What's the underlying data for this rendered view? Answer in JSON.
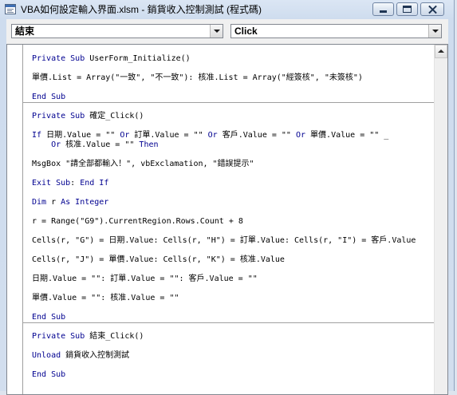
{
  "window": {
    "title": "VBA如何設定輸入界面.xlsm - 銷貨收入控制測試 (程式碼)",
    "icon": "code-window-icon",
    "caption_buttons": [
      "minimize-icon",
      "maximize-icon",
      "close-icon"
    ]
  },
  "toolbar": {
    "object_dropdown": {
      "value": "結束",
      "icon": "dropdown-arrow-icon"
    },
    "procedure_dropdown": {
      "value": "Click",
      "icon": "dropdown-arrow-icon"
    }
  },
  "editor": {
    "colors": {
      "keyword": "#000090",
      "text": "#000000",
      "separator": "#a0a0a0",
      "background": "#ffffff"
    },
    "scrollbar": {
      "icon": "scroll-up-arrow-icon"
    },
    "procedures": [
      {
        "lines": [
          [
            {
              "text": "Private Sub",
              "keyword": true
            },
            {
              "text": " UserForm_Initialize()"
            }
          ],
          [],
          [
            {
              "text": "單價.List = Array(\"一致\", \"不一致\"): 核准.List = Array(\"經簽核\", \"未簽核\")"
            }
          ],
          [],
          [
            {
              "text": "End Sub",
              "keyword": true
            }
          ]
        ]
      },
      {
        "lines": [
          [],
          [
            {
              "text": "Private Sub",
              "keyword": true
            },
            {
              "text": " 確定_Click()"
            }
          ],
          [],
          [
            {
              "text": "If",
              "keyword": true
            },
            {
              "text": " 日期.Value = \"\" "
            },
            {
              "text": "Or",
              "keyword": true
            },
            {
              "text": " 訂單.Value = \"\" "
            },
            {
              "text": "Or",
              "keyword": true
            },
            {
              "text": " 客戶.Value = \"\" "
            },
            {
              "text": "Or",
              "keyword": true
            },
            {
              "text": " 單價.Value = \"\" _"
            }
          ],
          [
            {
              "text": "    "
            },
            {
              "text": "Or",
              "keyword": true
            },
            {
              "text": " 核准.Value = \"\" "
            },
            {
              "text": "Then",
              "keyword": true
            }
          ],
          [],
          [
            {
              "text": "MsgBox \"請全部都輸入！\", vbExclamation, \"錯誤提示\""
            }
          ],
          [],
          [
            {
              "text": "Exit Sub",
              "keyword": true
            },
            {
              "text": ": "
            },
            {
              "text": "End If",
              "keyword": true
            }
          ],
          [],
          [
            {
              "text": "Dim",
              "keyword": true
            },
            {
              "text": " r "
            },
            {
              "text": "As Integer",
              "keyword": true
            }
          ],
          [],
          [
            {
              "text": "r = Range(\"G9\").CurrentRegion.Rows.Count + 8"
            }
          ],
          [],
          [
            {
              "text": "Cells(r, \"G\") = 日期.Value: Cells(r, \"H\") = 訂單.Value: Cells(r, \"I\") = 客戶.Value"
            }
          ],
          [],
          [
            {
              "text": "Cells(r, \"J\") = 單價.Value: Cells(r, \"K\") = 核准.Value"
            }
          ],
          [],
          [
            {
              "text": "日期.Value = \"\": 訂單.Value = \"\": 客戶.Value = \"\""
            }
          ],
          [],
          [
            {
              "text": "單價.Value = \"\": 核准.Value = \"\""
            }
          ],
          [],
          [
            {
              "text": "End Sub",
              "keyword": true
            }
          ]
        ]
      },
      {
        "lines": [
          [],
          [
            {
              "text": "Private Sub",
              "keyword": true
            },
            {
              "text": " 結束_Click()"
            }
          ],
          [],
          [
            {
              "text": "Unload",
              "keyword": true
            },
            {
              "text": " 銷貨收入控制測試"
            }
          ],
          [],
          [
            {
              "text": "End Sub",
              "keyword": true
            }
          ]
        ]
      }
    ]
  }
}
